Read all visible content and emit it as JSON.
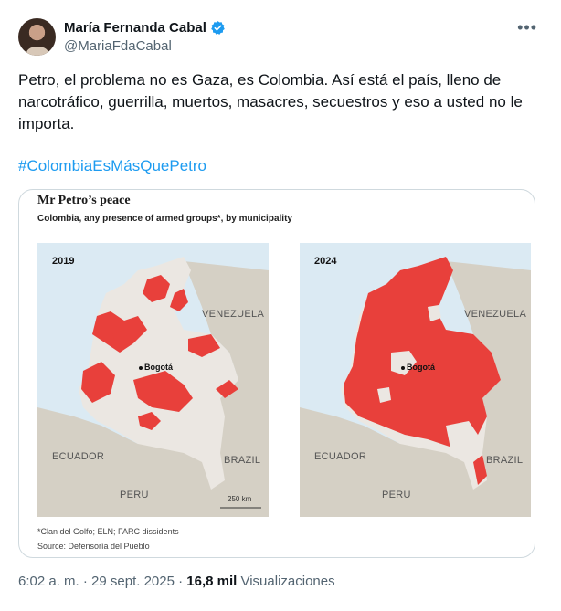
{
  "author": {
    "name": "María Fernanda Cabal",
    "handle": "@MariaFdaCabal"
  },
  "tweet": {
    "text": "Petro, el problema no es Gaza, es Colombia. Así está el país, lleno de narcotráfico, guerrilla, muertos, masacres, secuestros y eso a usted no le importa.",
    "hashtag": "#ColombiaEsMásQuePetro"
  },
  "media": {
    "title": "Mr Petro’s peace",
    "subtitle": "Colombia, any presence of armed groups*, by municipality",
    "maps": [
      {
        "year": "2019",
        "labels": {
          "venezuela": "VENEZUELA",
          "ecuador": "ECUADOR",
          "peru": "PERU",
          "brazil": "BRAZIL",
          "city": "Bogotá"
        },
        "scale": "250 km"
      },
      {
        "year": "2024",
        "labels": {
          "venezuela": "VENEZUELA",
          "ecuador": "ECUADOR",
          "peru": "PERU",
          "brazil": "BRAZIL",
          "city": "Bogotá"
        }
      }
    ],
    "footnote": "*Clan del Golfo; ELN; FARC dissidents",
    "source": "Source: Defensoría del Pueblo",
    "colors": {
      "presence": "#e8403b",
      "colombia": "#ebe7e2",
      "neighbors": "#d5d0c5",
      "sea": "#dbeaf3"
    }
  },
  "meta": {
    "time": "6:02 a. m. · 29 sept. 2025 · ",
    "views": "16,8 mil",
    "views_label": " Visualizaciones"
  }
}
